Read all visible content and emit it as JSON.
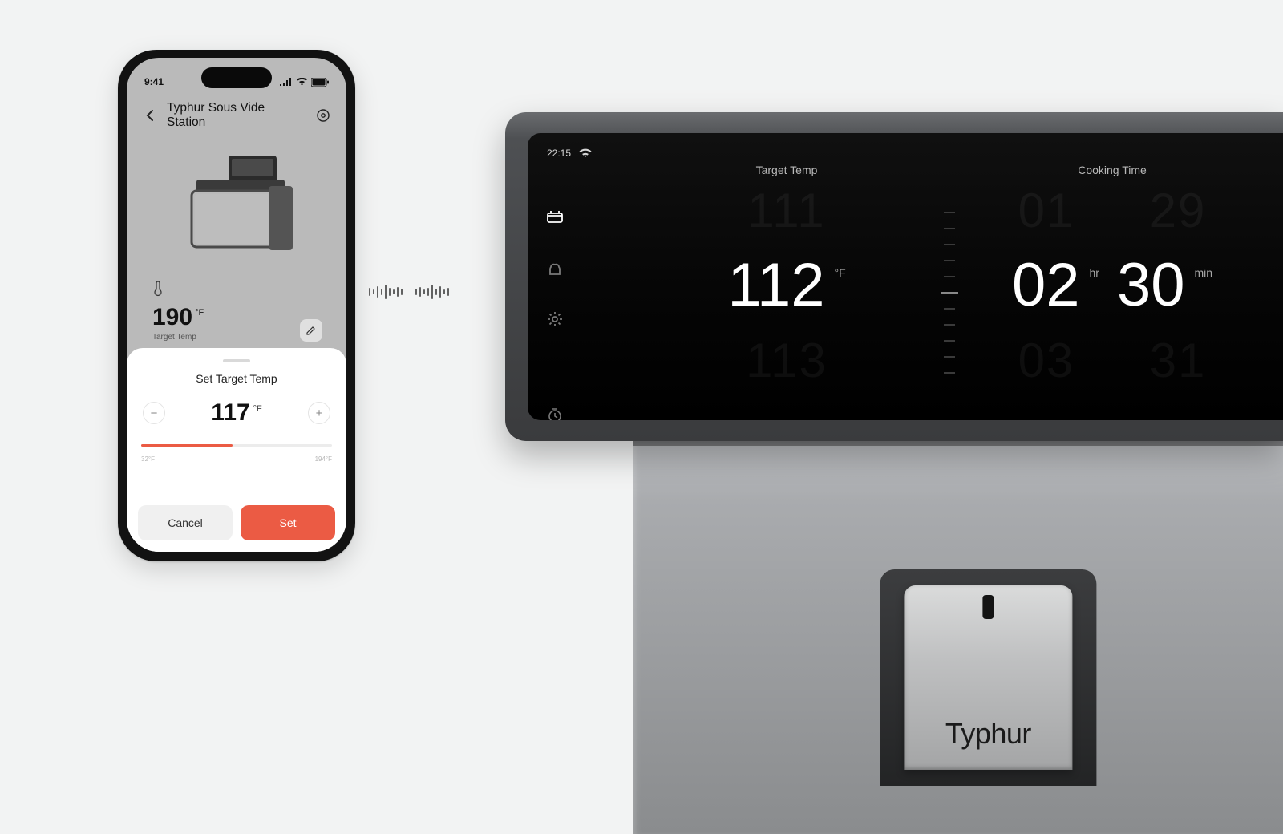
{
  "phone": {
    "time": "9:41",
    "title": "Typhur Sous Vide Station",
    "card": {
      "value": "190",
      "unit": "°F",
      "label": "Target Temp"
    },
    "sheet": {
      "title": "Set Target Temp",
      "value": "117",
      "unit": "°F",
      "min": "32°F",
      "max": "194°F",
      "cancel": "Cancel",
      "set": "Set"
    }
  },
  "pulse_heights": [
    10,
    6,
    14,
    8,
    18,
    10,
    6,
    12,
    8,
    0,
    8,
    12,
    6,
    10,
    18,
    8,
    14,
    6,
    10
  ],
  "device": {
    "time": "22:15",
    "target_label": "Target Temp",
    "cook_label": "Cooking Time",
    "temp": {
      "prev": "111",
      "value": "112",
      "next": "113",
      "unit": "°F"
    },
    "time_hr": {
      "prev": "01",
      "value": "02",
      "next": "03",
      "unit": "hr"
    },
    "time_min": {
      "prev": "29",
      "value": "30",
      "next": "31",
      "unit": "min"
    },
    "brand": "Typhur"
  }
}
